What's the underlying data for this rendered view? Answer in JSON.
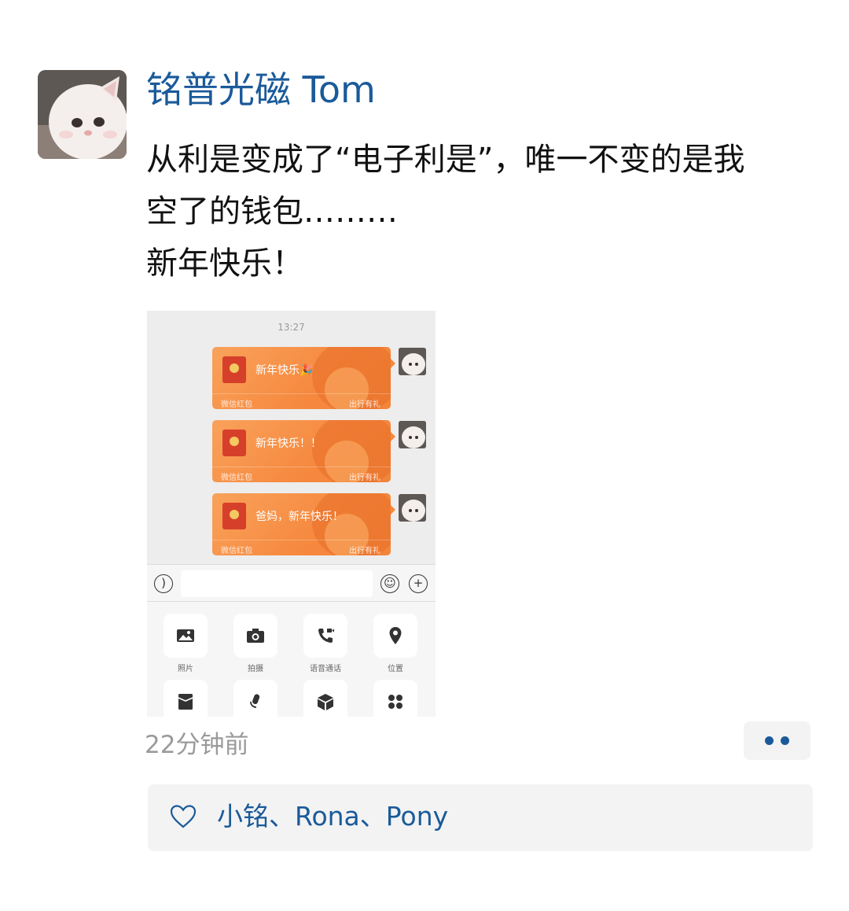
{
  "post": {
    "author": "铭普光磁 Tom",
    "text_lines": [
      "从利是变成了“电子利是”，唯一不变的是我",
      "空了的钱包………",
      "新年快乐！"
    ],
    "timestamp": "22分钟前"
  },
  "screenshot": {
    "time": "13:27",
    "red_packets": [
      {
        "message": "新年快乐🎉",
        "label": "微信红包",
        "tag": "出行有礼"
      },
      {
        "message": "新年快乐！！",
        "label": "微信红包",
        "tag": "出行有礼"
      },
      {
        "message": "爸妈，新年快乐！",
        "label": "微信红包",
        "tag": "出行有礼"
      }
    ],
    "tools": [
      {
        "label": "照片",
        "icon": "photo-icon"
      },
      {
        "label": "拍摄",
        "icon": "camera-icon"
      },
      {
        "label": "语音通话",
        "icon": "voice-call-icon"
      },
      {
        "label": "位置",
        "icon": "location-icon"
      },
      {
        "label": "",
        "icon": "red-packet-icon"
      },
      {
        "label": "",
        "icon": "microphone-icon"
      },
      {
        "label": "",
        "icon": "box-icon"
      },
      {
        "label": "",
        "icon": "grid-icon"
      }
    ]
  },
  "likes": {
    "names": "小铭、Rona、Pony",
    "icon": "heart-icon"
  },
  "colors": {
    "link_blue": "#1a5a9a",
    "packet_orange": "#f6893f",
    "timestamp_gray": "#9a9a9a"
  }
}
